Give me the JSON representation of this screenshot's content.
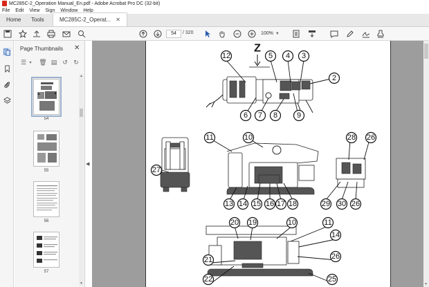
{
  "window": {
    "title": "MC285C-2_Operation Manual_En.pdf - Adobe Acrobat Pro DC (32-bit)"
  },
  "menu": [
    "File",
    "Edit",
    "View",
    "Sign",
    "Window",
    "Help"
  ],
  "tabs": {
    "home": "Home",
    "tools": "Tools",
    "document": "MC285C-2_Operat..."
  },
  "toolbar": {
    "page_current": "54",
    "page_total": "/ 320",
    "zoom": "100%",
    "icons": [
      "prev-page-icon",
      "next-page-icon",
      "select-cursor-icon",
      "hand-icon",
      "zoom-out-icon",
      "zoom-in-icon",
      "page-fit-icon",
      "scroll-mode-icon",
      "comment-icon",
      "highlight-icon",
      "sign-icon",
      "stamp-icon"
    ]
  },
  "sidebar": {
    "icons": [
      "page-thumbnails-icon",
      "bookmark-icon",
      "attachment-icon",
      "layers-icon"
    ]
  },
  "thumbnails": {
    "title": "Page Thumbnails",
    "pages": [
      "54",
      "55",
      "56",
      "57"
    ]
  },
  "document": {
    "view_label": "Z",
    "callouts_top": [
      "12",
      "5",
      "4",
      "3",
      "2",
      "6",
      "7",
      "8",
      "9"
    ],
    "callouts_middle": [
      "11",
      "10",
      "28",
      "26",
      "27",
      "13",
      "14",
      "15",
      "16",
      "17",
      "18",
      "29",
      "30",
      "26"
    ],
    "callouts_bottom": [
      "20",
      "19",
      "10",
      "11",
      "14",
      "21",
      "26",
      "22",
      "25"
    ]
  }
}
